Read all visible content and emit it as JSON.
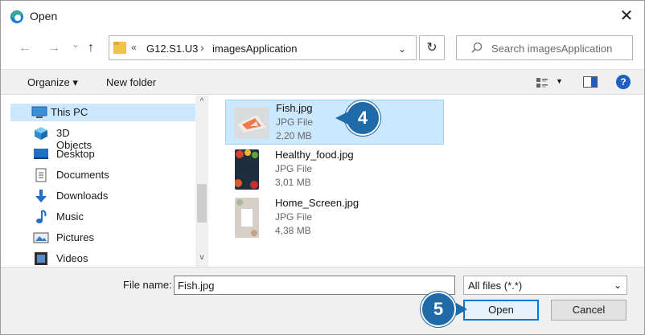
{
  "window": {
    "title": "Open",
    "close_glyph": "✕"
  },
  "nav": {
    "back": "←",
    "forward": "→",
    "recent": "⌄",
    "up": "↑"
  },
  "address": {
    "overflow": "«",
    "crumbs": [
      "G12.S1.U3",
      "imagesApplication"
    ],
    "separator": "›",
    "dropdown": "⌄",
    "refresh": "↻"
  },
  "search": {
    "placeholder": "Search imagesApplication"
  },
  "toolbar": {
    "organize": "Organize ▾",
    "new_folder": "New folder",
    "help": "?"
  },
  "navpane": {
    "items": [
      {
        "label": "This PC",
        "icon": "pc-icon"
      },
      {
        "label": "3D Objects",
        "icon": "cube-icon"
      },
      {
        "label": "Desktop",
        "icon": "desktop-icon"
      },
      {
        "label": "Documents",
        "icon": "document-icon"
      },
      {
        "label": "Downloads",
        "icon": "download-icon"
      },
      {
        "label": "Music",
        "icon": "music-icon"
      },
      {
        "label": "Pictures",
        "icon": "pictures-icon"
      },
      {
        "label": "Videos",
        "icon": "video-icon"
      }
    ],
    "scroll_up": "^",
    "scroll_down": "v"
  },
  "files": [
    {
      "name": "Fish.jpg",
      "type": "JPG File",
      "size": "2,20 MB",
      "selected": true
    },
    {
      "name": "Healthy_food.jpg",
      "type": "JPG File",
      "size": "3,01 MB",
      "selected": false
    },
    {
      "name": "Home_Screen.jpg",
      "type": "JPG File",
      "size": "4,38 MB",
      "selected": false
    }
  ],
  "callouts": {
    "step4": "4",
    "step5": "5"
  },
  "footer": {
    "file_name_label": "File name:",
    "file_name_value": "Fish.jpg",
    "filter": "All files (*.*)",
    "filter_chevron": "⌄",
    "open": "Open",
    "cancel": "Cancel"
  },
  "colors": {
    "selection": "#cce8ff",
    "accent": "#0078d7",
    "callout": "#1f6aa8"
  }
}
